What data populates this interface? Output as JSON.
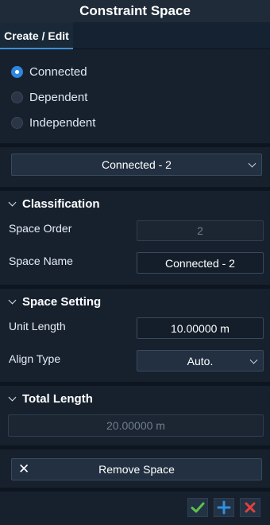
{
  "window": {
    "title": "Constraint Space"
  },
  "tabs": [
    {
      "label": "Create / Edit",
      "active": true
    }
  ],
  "type_options": {
    "selected": "Connected",
    "items": [
      {
        "label": "Connected",
        "checked": true
      },
      {
        "label": "Dependent",
        "checked": false
      },
      {
        "label": "Independent",
        "checked": false
      }
    ]
  },
  "space_select": {
    "value": "Connected - 2"
  },
  "classification": {
    "title": "Classification",
    "space_order_label": "Space Order",
    "space_order_value": "2",
    "space_name_label": "Space Name",
    "space_name_value": "Connected - 2"
  },
  "space_setting": {
    "title": "Space Setting",
    "unit_length_label": "Unit Length",
    "unit_length_value": "10.00000 m",
    "align_type_label": "Align Type",
    "align_type_value": "Auto."
  },
  "total_length": {
    "title": "Total Length",
    "value": "20.00000 m"
  },
  "remove_button": {
    "label": "Remove Space"
  },
  "footer": {
    "icons": [
      "check-icon",
      "plus-icon",
      "close-icon"
    ],
    "colors": {
      "check": "#5cc24a",
      "plus": "#2f8fe0",
      "close": "#e0413a"
    }
  }
}
